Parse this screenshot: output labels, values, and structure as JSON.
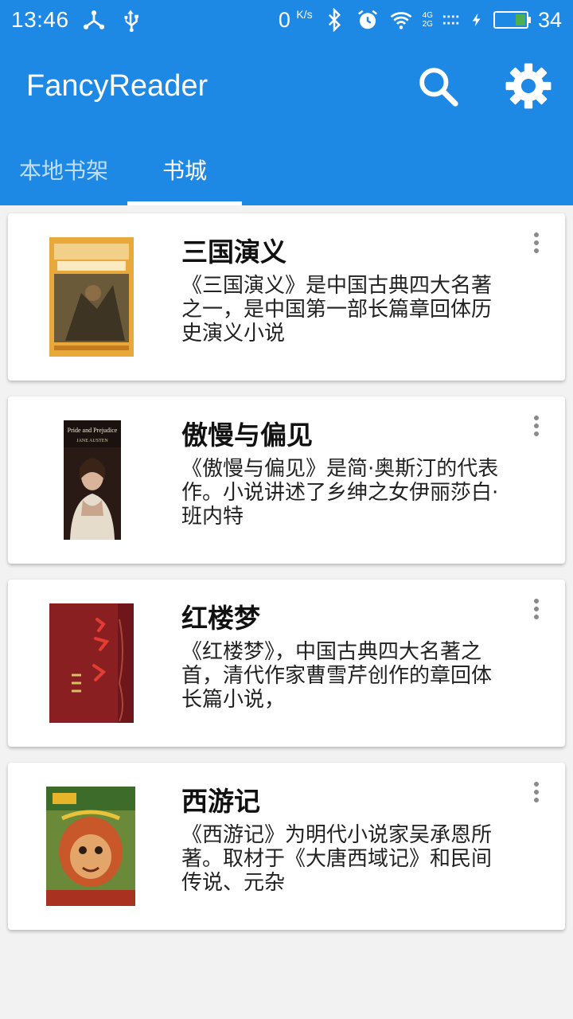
{
  "status_bar": {
    "time": "13:46",
    "speed": "0",
    "speed_unit": "K/s",
    "net_4g": "4G",
    "net_2g": "2G",
    "battery": "34",
    "battery_color": "#4caf50"
  },
  "toolbar": {
    "title": "FancyReader",
    "search_icon": "search-icon",
    "settings_icon": "gear-icon"
  },
  "tabs": [
    {
      "label": "本地书架",
      "active": false
    },
    {
      "label": "书城",
      "active": true
    }
  ],
  "books": [
    {
      "title": "三国演义",
      "description": "《三国演义》是中国古典四大名著之一，是中国第一部长篇章回体历史演义小说"
    },
    {
      "title": "傲慢与偏见",
      "description": "《傲慢与偏见》是简·奥斯汀的代表作。小说讲述了乡绅之女伊丽莎白·班内特",
      "cover_title": "Pride and Prejudice",
      "cover_author": "JANE AUSTEN"
    },
    {
      "title": "红楼梦",
      "description": "《红楼梦》，中国古典四大名著之首，清代作家曹雪芹创作的章回体长篇小说，"
    },
    {
      "title": "西游记",
      "description": "《西游记》为明代小说家吴承恩所著。取材于《大唐西域记》和民间传说、元杂"
    }
  ],
  "colors": {
    "primary": "#1e88e5",
    "background": "#f2f2f2"
  }
}
